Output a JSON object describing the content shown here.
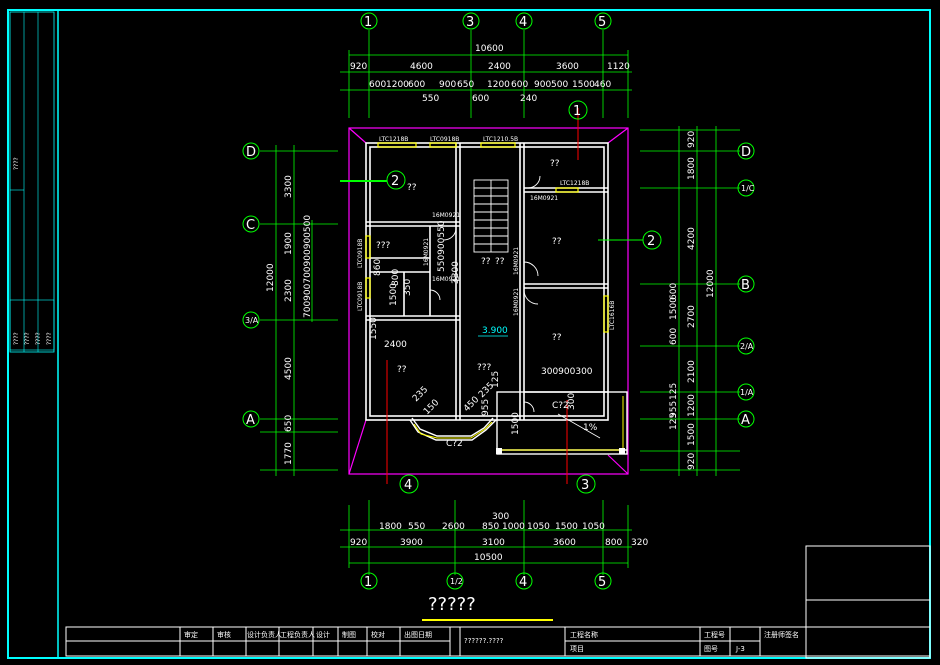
{
  "drawing_title": "?????",
  "elevation_mark": "3.900",
  "top_axes": [
    "1",
    "3",
    "4",
    "5"
  ],
  "bottom_axes": [
    "1",
    "1/2",
    "4",
    "5"
  ],
  "left_axes": [
    "D",
    "C",
    "3/A",
    "A"
  ],
  "right_axes": [
    "D",
    "1/C",
    "B",
    "2/A",
    "1/A",
    "A"
  ],
  "top_dims": {
    "total": "10600",
    "row1": [
      "920",
      "4600",
      "2400",
      "3600",
      "1120"
    ],
    "row2": [
      "600",
      "1200",
      "600",
      "900",
      "650",
      "1200",
      "600",
      "900",
      "500",
      "1500",
      "460"
    ],
    "row3": [
      "550",
      "600",
      "240"
    ]
  },
  "bottom_dims": {
    "total": "10500",
    "extra": "300",
    "row1": [
      "1800",
      "550",
      "2600",
      "850",
      "1000",
      "1050",
      "1500",
      "1050"
    ],
    "row2": [
      "920",
      "3900",
      "3100",
      "3600",
      "800",
      "320"
    ]
  },
  "left_dims": {
    "total": "12000",
    "outer": [
      "3300",
      "1900",
      "2300",
      "4500",
      "650",
      "1770"
    ],
    "inner": "700900700900900500"
  },
  "right_dims": {
    "total": "12000",
    "outer": [
      "920",
      "1800",
      "4200",
      "2700",
      "2100",
      "1200",
      "1500",
      "920"
    ],
    "inner": [
      "600",
      "600",
      "1500",
      "600",
      "125",
      "125",
      "955",
      "125"
    ]
  },
  "window_tags": [
    "LTC1218B",
    "LTC0918B",
    "LTC1210.5B",
    "LTC1218B",
    "LTC0918B",
    "LTC0918B",
    "LTC1616B"
  ],
  "door_tags": [
    "16M0921",
    "16M0921",
    "16M0921",
    "16M0921",
    "16M0921",
    "16M0921"
  ],
  "misc_dims": [
    "2400",
    "1550",
    "300900300",
    "235",
    "235",
    "150",
    "450",
    "955",
    "125",
    "860",
    "800",
    "350",
    "3300",
    "550900550",
    "1500",
    "1500",
    "300"
  ],
  "rooms": [
    "??",
    "??",
    "???",
    "??",
    "??",
    "??",
    "???",
    "??",
    "??"
  ],
  "section_markers": [
    "1",
    "2",
    "2",
    "4",
    "3"
  ],
  "bay_window_label": "C?2",
  "balcony_label": "C?2",
  "slope_label": "1%",
  "sidebar_labels": [
    "????",
    "????",
    "????",
    "????",
    "????"
  ],
  "title_block": {
    "headers": [
      "审定",
      "审核",
      "设计负责人",
      "工程负责人",
      "设计",
      "制图",
      "校对",
      "出图日期"
    ],
    "drawing_name": "??????.????",
    "project_name_label": "工程名称",
    "project_label": "项目",
    "project_no_label": "工程号",
    "drawing_no_label": "图号",
    "drawing_no": "J-3",
    "registered_label": "注册师签名"
  },
  "colors": {
    "frame": "#00ffff",
    "wall": "#ffffff",
    "dim_line": "#00ff00",
    "roof_outline": "#ff00ff",
    "window": "#ffff00",
    "axis_line": "#ff0000",
    "title_underline": "#ffff00"
  }
}
